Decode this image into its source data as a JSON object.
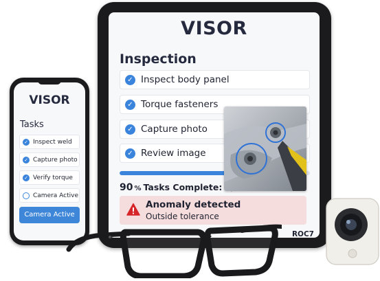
{
  "tablet": {
    "title": "VISOR",
    "section": "Inspection",
    "items": [
      {
        "label": "Inspect body panel",
        "checked": true
      },
      {
        "label": "Torque fasteners",
        "checked": true
      },
      {
        "label": "Capture photo",
        "checked": true
      },
      {
        "label": "Review image",
        "checked": true
      }
    ],
    "progress": {
      "percent": 90,
      "percent_value": "90",
      "percent_symbol": "%",
      "tasks_text": "Tasks Complete: 9/10"
    },
    "alert": {
      "title": "Anomaly detected",
      "subtitle": "Outside tolerance",
      "icon": "warning-triangle-icon",
      "color": "#d7262a"
    },
    "footer_code": "ROC7"
  },
  "phone": {
    "title": "VISOR",
    "section": "Tasks",
    "items": [
      {
        "label": "Inspect weld",
        "checked": true
      },
      {
        "label": "Capture photo",
        "checked": true
      },
      {
        "label": "Verify torque",
        "checked": true
      },
      {
        "label": "Camera Active",
        "checked": false
      }
    ],
    "button_label": "Camera Active"
  },
  "colors": {
    "accent": "#3a84dc",
    "text": "#262a3e",
    "alert_background": "#f6dddd",
    "device_body": "#1b1b1d"
  }
}
